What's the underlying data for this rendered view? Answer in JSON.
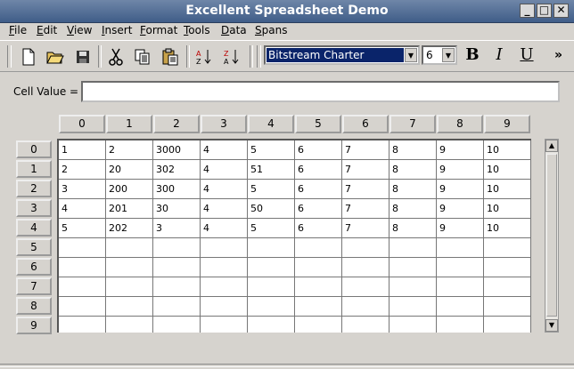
{
  "window": {
    "title": "Excellent Spreadsheet Demo"
  },
  "menu": [
    "File",
    "Edit",
    "View",
    "Insert",
    "Format",
    "Tools",
    "Data",
    "Spans"
  ],
  "toolbar": {
    "font_name": "Bitstream Charter",
    "font_size": "6",
    "bold_label": "B",
    "italic_label": "I",
    "underline_label": "U",
    "overflow_label": "»"
  },
  "cell_value": {
    "label": "Cell Value =",
    "value": ""
  },
  "columns": [
    "0",
    "1",
    "2",
    "3",
    "4",
    "5",
    "6",
    "7",
    "8",
    "9"
  ],
  "rows": [
    "0",
    "1",
    "2",
    "3",
    "4",
    "5",
    "6",
    "7",
    "8",
    "9"
  ],
  "cells": [
    [
      "1",
      "2",
      "3000",
      "4",
      "5",
      "6",
      "7",
      "8",
      "9",
      "10"
    ],
    [
      "2",
      "20",
      "302",
      "4",
      "51",
      "6",
      "7",
      "8",
      "9",
      "10"
    ],
    [
      "3",
      "200",
      "300",
      "4",
      "5",
      "6",
      "7",
      "8",
      "9",
      "10"
    ],
    [
      "4",
      "201",
      "30",
      "4",
      "50",
      "6",
      "7",
      "8",
      "9",
      "10"
    ],
    [
      "5",
      "202",
      "3",
      "4",
      "5",
      "6",
      "7",
      "8",
      "9",
      "10"
    ],
    [
      "",
      "",
      "",
      "",
      "",
      "",
      "",
      "",
      "",
      ""
    ],
    [
      "",
      "",
      "",
      "",
      "",
      "",
      "",
      "",
      "",
      ""
    ],
    [
      "",
      "",
      "",
      "",
      "",
      "",
      "",
      "",
      "",
      ""
    ],
    [
      "",
      "",
      "",
      "",
      "",
      "",
      "",
      "",
      "",
      ""
    ],
    [
      "",
      "",
      "",
      "",
      "",
      "",
      "",
      "",
      "",
      ""
    ]
  ]
}
